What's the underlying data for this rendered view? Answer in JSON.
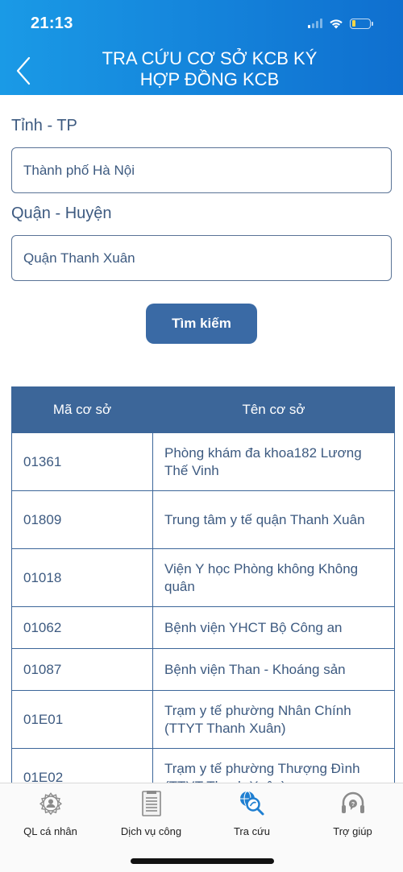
{
  "status_bar": {
    "time": "21:13",
    "icons": [
      "cellular-signal-icon",
      "wifi-icon",
      "battery-low-icon"
    ],
    "battery_level": 0.2,
    "battery_color": "#f5d547"
  },
  "header": {
    "back_icon": "chevron-left-icon",
    "title_line1": "TRA CỨU CƠ SỞ KCB KÝ",
    "title_line2": "HỢP ĐỒNG KCB",
    "gradient_start": "#1a9ae6",
    "gradient_end": "#0f6fcf"
  },
  "form": {
    "province_label": "Tỉnh - TP",
    "province_value": "Thành phố Hà Nội",
    "district_label": "Quận - Huyện",
    "district_value": "Quận Thanh Xuân",
    "search_button": "Tìm kiếm",
    "accent_color": "#3a6aa5"
  },
  "table": {
    "columns": [
      "Mã cơ sở",
      "Tên cơ sở"
    ],
    "rows": [
      {
        "code": "01361",
        "name": "Phòng khám đa khoa182 Lương Thế Vinh"
      },
      {
        "code": "01809",
        "name": "Trung tâm y tế quận Thanh Xuân"
      },
      {
        "code": "01018",
        "name": "Viện Y học Phòng không Không quân"
      },
      {
        "code": "01062",
        "name": "Bệnh viện YHCT Bộ Công an"
      },
      {
        "code": "01087",
        "name": "Bệnh viện Than - Khoáng sản"
      },
      {
        "code": "01E01",
        "name": "Trạm y tế phường Nhân Chính (TTYT Thanh Xuân)"
      },
      {
        "code": "01E02",
        "name": "Trạm y tế phường Thượng Đình (TTYT Thanh Xuân)"
      }
    ]
  },
  "bottom_nav": {
    "active_index": 2,
    "active_color": "#1f7fd1",
    "inactive_color": "#888888",
    "items": [
      {
        "label": "QL cá nhân",
        "icon": "user-gear-icon"
      },
      {
        "label": "Dịch vụ công",
        "icon": "clipboard-icon"
      },
      {
        "label": "Tra cứu",
        "icon": "globe-search-icon"
      },
      {
        "label": "Trợ giúp",
        "icon": "headset-help-icon"
      }
    ]
  }
}
